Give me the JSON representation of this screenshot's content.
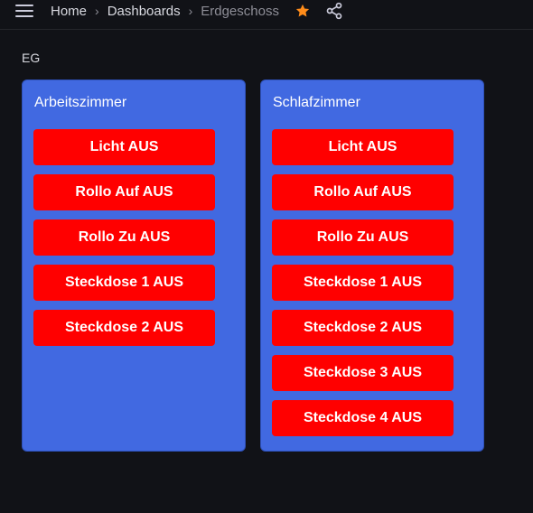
{
  "nav": {
    "breadcrumbs": [
      "Home",
      "Dashboards",
      "Erdgeschoss"
    ],
    "separator": "›",
    "starred": true,
    "star_color": "#ff8c1a"
  },
  "row": {
    "title": "EG"
  },
  "panels": [
    {
      "title": "Arbeitszimmer",
      "buttons": [
        "Licht AUS",
        "Rollo Auf AUS",
        "Rollo Zu AUS",
        "Steckdose 1 AUS",
        "Steckdose 2 AUS"
      ]
    },
    {
      "title": "Schlafzimmer",
      "buttons": [
        "Licht AUS",
        "Rollo Auf AUS",
        "Rollo Zu AUS",
        "Steckdose 1 AUS",
        "Steckdose 2 AUS",
        "Steckdose 3 AUS",
        "Steckdose 4 AUS"
      ]
    }
  ],
  "colors": {
    "panel_bg": "#4169e1",
    "button_bg": "#ff0000",
    "page_bg": "#111217"
  }
}
